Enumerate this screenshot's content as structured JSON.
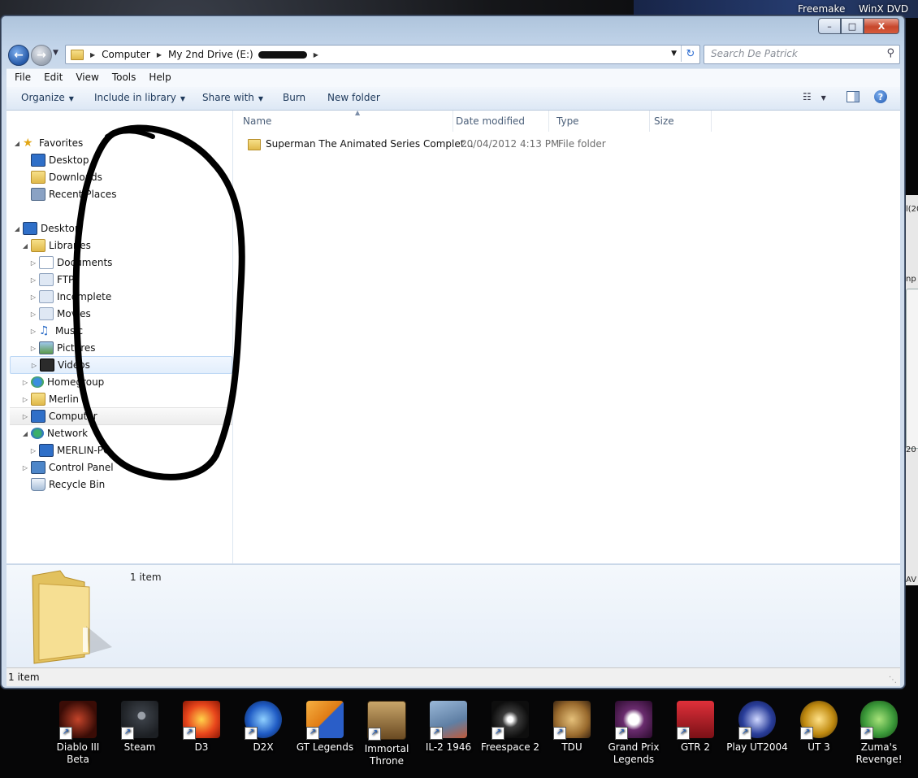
{
  "desktop": {
    "top_labels": [
      "Freemake",
      "WinX DVD"
    ],
    "icons": [
      {
        "label": "Diablo III Beta",
        "color": "#7a1d0e"
      },
      {
        "label": "Steam",
        "color": "#2d3137"
      },
      {
        "label": "D3",
        "color": "#e8461c"
      },
      {
        "label": "D2X",
        "color": "#1f5bc4"
      },
      {
        "label": "GT Legends",
        "color": "#e07b14"
      },
      {
        "label": "Immortal Throne",
        "color": "#8a6a3a"
      },
      {
        "label": "IL-2 1946",
        "color": "#5f7fa4"
      },
      {
        "label": "Freespace 2",
        "color": "#1b1b1b"
      },
      {
        "label": "TDU",
        "color": "#9a6b2e"
      },
      {
        "label": "Grand Prix Legends",
        "color": "#6a2c6e"
      },
      {
        "label": "GTR 2",
        "color": "#c0202a"
      },
      {
        "label": "Play UT2004",
        "color": "#2a3e9a"
      },
      {
        "label": "UT 3",
        "color": "#c08a10"
      },
      {
        "label": "Zuma's Revenge!",
        "color": "#3c9a3a"
      }
    ]
  },
  "window": {
    "caption_buttons": {
      "minimize": "–",
      "maximize": "□",
      "close": "X"
    },
    "address": {
      "crumbs": [
        "Computer",
        "My 2nd Drive (E:)"
      ]
    },
    "search_placeholder": "Search De Patrick",
    "menu": [
      "File",
      "Edit",
      "View",
      "Tools",
      "Help"
    ],
    "commands": [
      {
        "label": "Organize",
        "dropdown": true
      },
      {
        "label": "Include in library",
        "dropdown": true
      },
      {
        "label": "Share with",
        "dropdown": true
      },
      {
        "label": "Burn",
        "dropdown": false
      },
      {
        "label": "New folder",
        "dropdown": false
      }
    ],
    "nav_tree": [
      {
        "label": "Favorites",
        "icon": "star-icon"
      },
      {
        "label": "Desktop",
        "icon": "desktop-icon"
      },
      {
        "label": "Downloads",
        "icon": "downloads-icon"
      },
      {
        "label": "Recent Places",
        "icon": "recent-places-icon"
      },
      {
        "label": "Desktop",
        "icon": "desktop-icon"
      },
      {
        "label": "Libraries",
        "icon": "libraries-icon"
      },
      {
        "label": "Documents",
        "icon": "documents-icon"
      },
      {
        "label": "FTP",
        "icon": "library-folder-icon"
      },
      {
        "label": "Incomplete",
        "icon": "library-folder-icon"
      },
      {
        "label": "Movies",
        "icon": "library-folder-icon"
      },
      {
        "label": "Music",
        "icon": "music-icon"
      },
      {
        "label": "Pictures",
        "icon": "pictures-icon"
      },
      {
        "label": "Videos",
        "icon": "videos-icon"
      },
      {
        "label": "Homegroup",
        "icon": "homegroup-icon"
      },
      {
        "label": "Merlin",
        "icon": "user-folder-icon"
      },
      {
        "label": "Computer",
        "icon": "computer-icon"
      },
      {
        "label": "Network",
        "icon": "network-icon"
      },
      {
        "label": "MERLIN-PC",
        "icon": "computer-icon"
      },
      {
        "label": "Control Panel",
        "icon": "control-panel-icon"
      },
      {
        "label": "Recycle Bin",
        "icon": "recycle-bin-icon"
      }
    ],
    "columns": [
      "Name",
      "Date modified",
      "Type",
      "Size"
    ],
    "files": [
      {
        "name": "Superman The Animated Series Complet...",
        "date": "20/04/2012 4:13 PM",
        "type": "File folder",
        "size": ""
      }
    ],
    "details_count": "1 item",
    "status_text": "1 item"
  }
}
